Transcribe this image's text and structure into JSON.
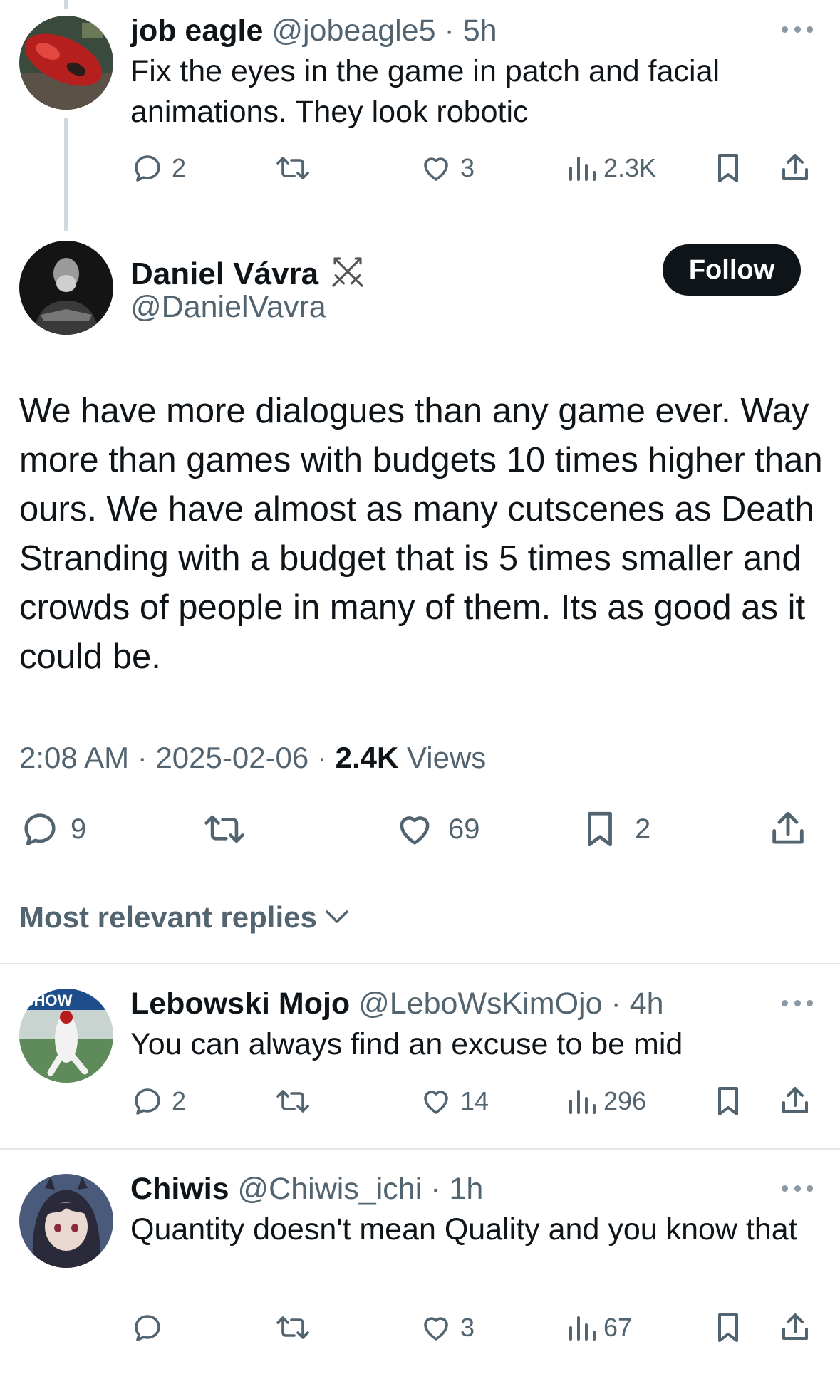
{
  "reply_top": {
    "name": "job eagle",
    "handle": "@jobeagle5",
    "sep": "·",
    "time": "5h",
    "text": "Fix the eyes in the game in patch and facial animations. They look robotic",
    "replies": "2",
    "retweets": "",
    "likes": "3",
    "views": "2.3K"
  },
  "main_tweet": {
    "name": "Daniel Vávra",
    "badge_icon": "crossed-swords-icon",
    "handle": "@DanielVavra",
    "follow_label": "Follow",
    "text": "We have more dialogues than any game ever. Way more than games with budgets 10 times higher than ours. We have almost as many cutscenes as Death Stranding with a budget that is 5 times smaller and crowds of people in many of them. Its as good as it could be.",
    "time": "2:08 AM",
    "sep1": " · ",
    "date": "2025-02-06",
    "sep2": " · ",
    "views_count": "2.4K",
    "views_label": " Views",
    "replies": "9",
    "likes": "69",
    "bookmarks": "2"
  },
  "sort_label": "Most relevant replies",
  "replies": [
    {
      "name": "Lebowski Mojo",
      "handle": "@LeboWsKimOjo",
      "sep": "·",
      "time": "4h",
      "text": "You can always find an excuse to be mid",
      "replies": "2",
      "likes": "14",
      "views": "296"
    },
    {
      "name": "Chiwis",
      "handle": "@Chiwis_ichi",
      "sep": "·",
      "time": "1h",
      "text": "Quantity doesn't mean Quality and you know that",
      "replies": "",
      "likes": "3",
      "views": "67"
    }
  ],
  "colors": {
    "text": "#0f1419",
    "secondary": "#536471",
    "divider": "#e3e8eb",
    "follow_bg": "#0f1419"
  }
}
